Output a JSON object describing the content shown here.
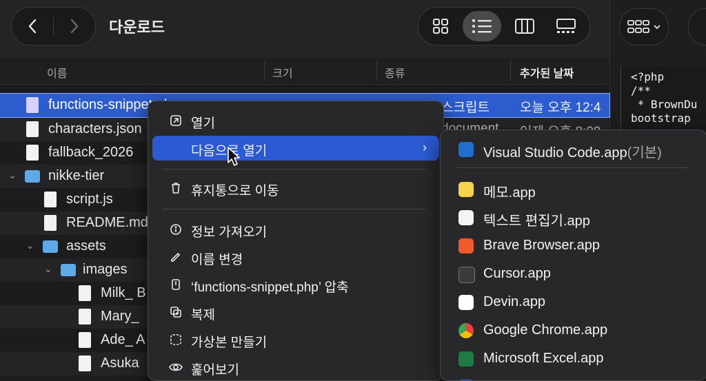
{
  "window": {
    "title": "다운로드"
  },
  "columns": {
    "name": "이름",
    "size": "크기",
    "kind": "종류",
    "date_added": "추가된 날짜"
  },
  "files": [
    {
      "name": "functions-snippet.php",
      "kind": "스크립트",
      "date": "오늘 오후 12:4",
      "selected": true
    },
    {
      "name": "characters.json",
      "kind": "document",
      "date": "어제 오후 8:09"
    },
    {
      "name": "fallback_2026"
    },
    {
      "name": "nikke-tier",
      "type": "folder"
    },
    {
      "name": "script.js"
    },
    {
      "name": "README.md"
    },
    {
      "name": "assets",
      "type": "folder"
    },
    {
      "name": "images",
      "type": "folder"
    },
    {
      "name": "Milk_ B"
    },
    {
      "name": "Mary_"
    },
    {
      "name": "Ade_ A"
    },
    {
      "name": "Asuka"
    }
  ],
  "context_menu": {
    "open": "열기",
    "open_with": "다음으로 열기",
    "move_to_trash": "휴지통으로 이동",
    "get_info": "정보 가져오기",
    "rename": "이름 변경",
    "compress": "‘functions-snippet.php’ 압축",
    "duplicate": "복제",
    "make_alias": "가상본 만들기",
    "quick_look": "훑어보기"
  },
  "open_with_menu": {
    "default_app": "Visual Studio Code.app",
    "default_suffix": "(기본)",
    "apps": [
      "메모.app",
      "텍스트 편집기.app",
      "Brave Browser.app",
      "Cursor.app",
      "Devin.app",
      "Google Chrome.app",
      "Microsoft Excel.app"
    ]
  },
  "preview_code": [
    "<?php",
    "/**",
    " * BrownDu",
    "bootstrap"
  ],
  "colors": {
    "selection": "#2b5ad3",
    "folder": "#5fa9e8",
    "menu_bg": "#28282a"
  }
}
